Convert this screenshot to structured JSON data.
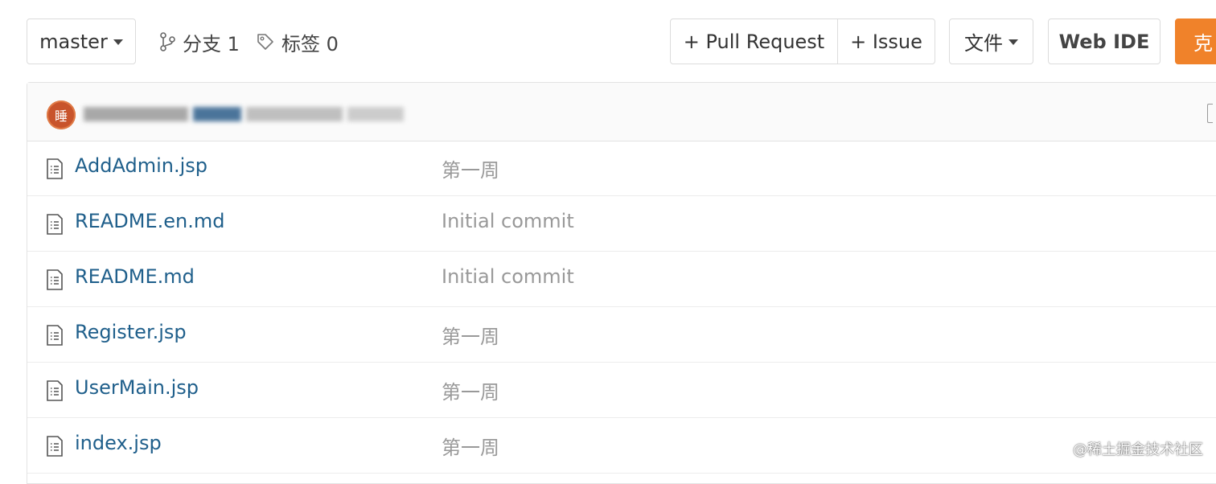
{
  "toolbar": {
    "branch_label": "master",
    "branches_label": "分支 1",
    "tags_label": "标签 0",
    "pull_request_label": "+ Pull Request",
    "issue_label": "+ Issue",
    "file_label": "文件",
    "web_ide_label": "Web IDE",
    "clone_label": "克"
  },
  "latest_commit": {
    "avatar_text": "睡"
  },
  "files": [
    {
      "name": "AddAdmin.jsp",
      "message": "第一周"
    },
    {
      "name": "README.en.md",
      "message": "Initial commit"
    },
    {
      "name": "README.md",
      "message": "Initial commit"
    },
    {
      "name": "Register.jsp",
      "message": "第一周"
    },
    {
      "name": "UserMain.jsp",
      "message": "第一周"
    },
    {
      "name": "index.jsp",
      "message": "第一周"
    }
  ],
  "watermark": "@稀土掘金技术社区",
  "colors": {
    "accent": "#f0822a",
    "link": "#1f5f8b",
    "muted": "#999999"
  }
}
